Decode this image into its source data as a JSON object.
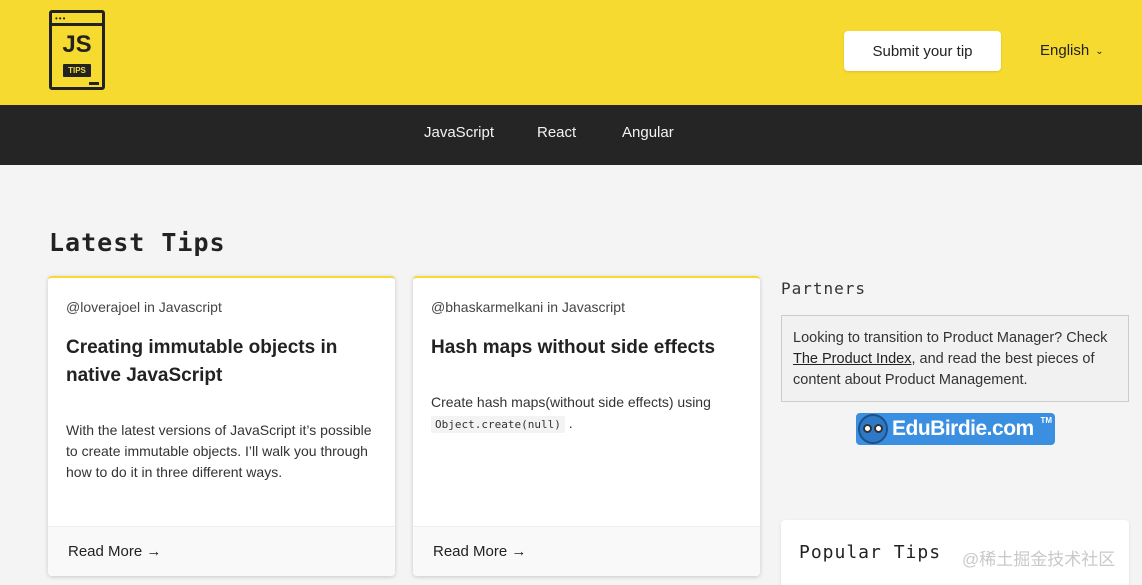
{
  "header": {
    "logo_text": "JS",
    "logo_badge": "TIPS",
    "submit_label": "Submit your tip",
    "language_label": "English",
    "colors": {
      "brand": "#f7da2f",
      "nav": "#252525"
    }
  },
  "nav": {
    "items": [
      {
        "label": "JavaScript"
      },
      {
        "label": "React"
      },
      {
        "label": "Angular"
      }
    ]
  },
  "main": {
    "section_title": "Latest Tips",
    "cards": [
      {
        "meta": "@loverajoel in Javascript",
        "title": "Creating immutable objects in native JavaScript",
        "body": "With the latest versions of JavaScript it’s possible to create immutable objects. I’ll walk you through how to do it in three different ways.",
        "read_more": "Read More →"
      },
      {
        "meta": "@bhaskarmelkani in Javascript",
        "title": "Hash maps without side effects",
        "body_prefix": "Create hash maps(without side effects) using",
        "body_code": "Object.create(null)",
        "body_suffix": ".",
        "read_more": "Read More →"
      }
    ]
  },
  "sidebar": {
    "partners_title": "Partners",
    "partner_text_1": "Looking to transition to Product Manager? Check",
    "partner_link": "The Product Index",
    "partner_text_2": ", and read the best pieces of content about Product Management.",
    "partner_logo_text": "EduBirdie.com",
    "partner_logo_tm": "TM",
    "popular_title": "Popular Tips"
  },
  "watermark": "@稀土掘金技术社区"
}
